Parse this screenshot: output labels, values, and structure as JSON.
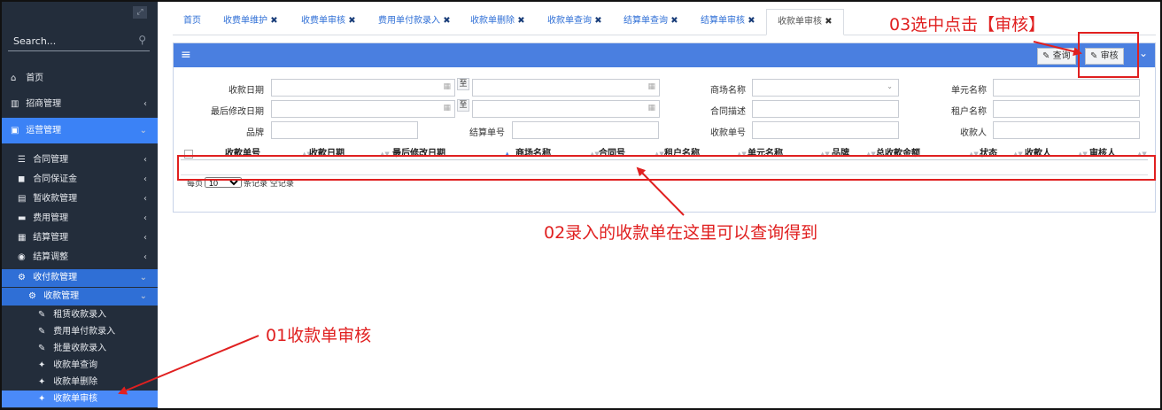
{
  "sidebar": {
    "search_placeholder": "Search...",
    "items": [
      {
        "icon": "home-icon",
        "glyph": "⌂",
        "label": "首页"
      },
      {
        "icon": "chart-icon",
        "glyph": "▥",
        "label": "招商管理"
      },
      {
        "icon": "operations-icon",
        "glyph": "▣",
        "label": "运营管理"
      },
      {
        "icon": "contract-icon",
        "glyph": "☰",
        "label": "合同管理"
      },
      {
        "icon": "deposit-icon",
        "glyph": "◼",
        "label": "合同保证金"
      },
      {
        "icon": "temp-collect-icon",
        "glyph": "▤",
        "label": "暂收款管理"
      },
      {
        "icon": "fee-icon",
        "glyph": "▬",
        "label": "费用管理"
      },
      {
        "icon": "settlement-icon",
        "glyph": "▦",
        "label": "结算管理"
      },
      {
        "icon": "adjust-icon",
        "glyph": "◉",
        "label": "结算调整"
      },
      {
        "icon": "payment-icon",
        "glyph": "⚙",
        "label": "收付款管理"
      },
      {
        "icon": "receipt-icon",
        "glyph": "⚙",
        "label": "收款管理"
      },
      {
        "icon": "edit-icon",
        "glyph": "✎",
        "label": "租赁收款录入"
      },
      {
        "icon": "edit-icon",
        "glyph": "✎",
        "label": "费用单付款录入"
      },
      {
        "icon": "edit-icon",
        "glyph": "✎",
        "label": "批量收款录入"
      },
      {
        "icon": "query-icon",
        "glyph": "✦",
        "label": "收款单查询"
      },
      {
        "icon": "delete-icon",
        "glyph": "✦",
        "label": "收款单删除"
      },
      {
        "icon": "audit-icon",
        "glyph": "✦",
        "label": "收款单审核"
      }
    ]
  },
  "tabs": [
    {
      "label": "首页"
    },
    {
      "label": "收费单维护",
      "close": "✖"
    },
    {
      "label": "收费单审核",
      "close": "✖"
    },
    {
      "label": "费用单付款录入",
      "close": "✖"
    },
    {
      "label": "收款单删除",
      "close": "✖"
    },
    {
      "label": "收款单查询",
      "close": "✖"
    },
    {
      "label": "结算单查询",
      "close": "✖"
    },
    {
      "label": "结算单审核",
      "close": "✖"
    },
    {
      "label": "收款单审核",
      "close": "✖"
    }
  ],
  "toolbar": {
    "query_label": "查询",
    "audit_label": "审核"
  },
  "form": {
    "receipt_date": "收款日期",
    "last_modified": "最后修改日期",
    "brand": "品牌",
    "to": "至",
    "mall_name": "商场名称",
    "contract_desc": "合同描述",
    "settlement_no": "结算单号",
    "receipt_no": "收款单号",
    "unit_name": "单元名称",
    "tenant_name": "租户名称",
    "payee": "收款人"
  },
  "table": {
    "columns": [
      "收款单号",
      "收款日期",
      "最后修改日期",
      "商场名称",
      "合同号",
      "租户名称",
      "单元名称",
      "品牌",
      "总收款金额",
      "状态",
      "收款人",
      "审核人"
    ]
  },
  "pager": {
    "prefix": "每页",
    "page_size": "10",
    "suffix": "条记录 空记录"
  },
  "annotations": {
    "step1": "01收款单审核",
    "step2": "02录入的收款单在这里可以查询得到",
    "step3": "03选中点击【审核】"
  },
  "colors": {
    "sidebar_bg": "#232d3b",
    "accent": "#3b82f6",
    "panel_header": "#4a7fe0",
    "annotation_red": "#e02020"
  }
}
